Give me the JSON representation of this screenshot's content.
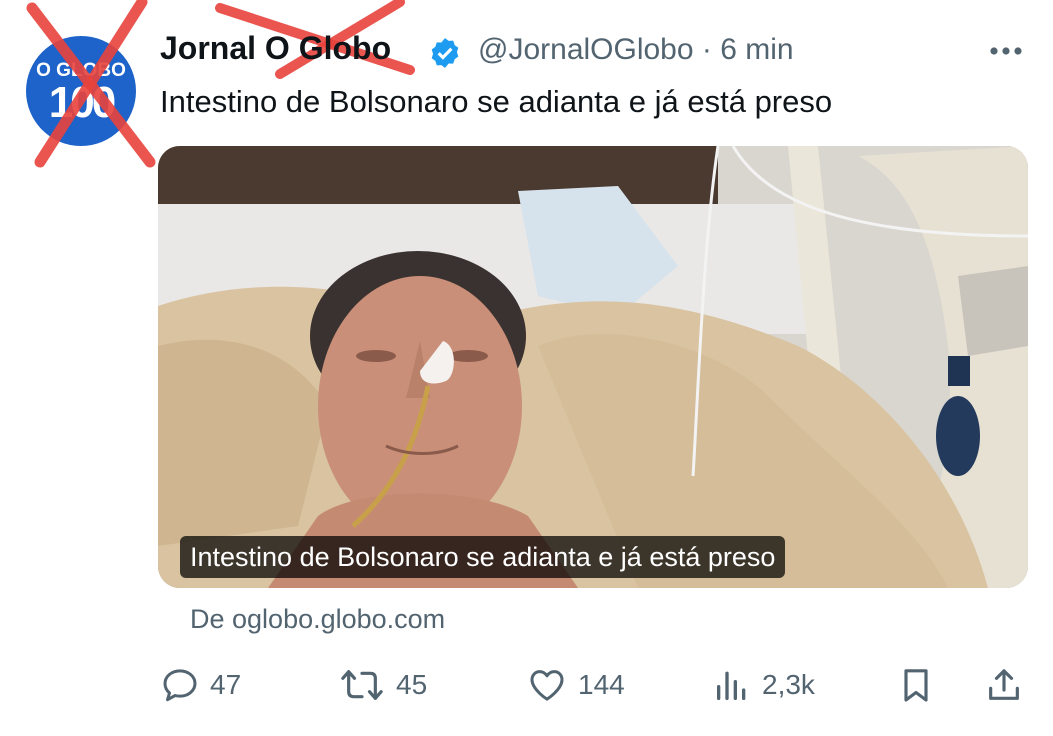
{
  "avatar": {
    "brand": "O GLOBO",
    "number": "100",
    "color": "#1d63c9"
  },
  "author": {
    "name": "Jornal O Globo",
    "verified": true,
    "handle": "@JornalOGlobo",
    "separator": "·",
    "time": "6 min"
  },
  "tweet": {
    "text": "Intestino de Bolsonaro se adianta e já está preso"
  },
  "media": {
    "caption": "Intestino de Bolsonaro se adianta e já está preso"
  },
  "source": {
    "text": "De oglobo.globo.com"
  },
  "actions": {
    "replies": "47",
    "reposts": "45",
    "likes": "144",
    "views": "2,3k"
  },
  "icons": [
    "more-icon",
    "verified-badge-icon",
    "reply-icon",
    "repost-icon",
    "like-icon",
    "views-icon",
    "bookmark-icon",
    "share-icon"
  ],
  "colors": {
    "accent": "#1d9bf0",
    "muted": "#536471",
    "cross": "#e8433c"
  }
}
